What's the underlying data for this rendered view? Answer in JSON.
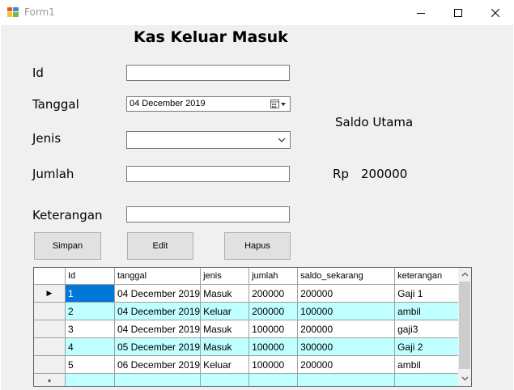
{
  "window": {
    "title": "Form1",
    "minimize_icon": "minimize-icon",
    "maximize_icon": "maximize-icon",
    "close_icon": "close-icon"
  },
  "form": {
    "heading": "Kas Keluar Masuk",
    "labels": {
      "id": "Id",
      "tanggal": "Tanggal",
      "jenis": "Jenis",
      "jumlah": "Jumlah",
      "keterangan": "Keterangan"
    },
    "fields": {
      "id_value": "",
      "tanggal_value": "04 December 2019",
      "jenis_value": "",
      "jumlah_value": "",
      "keterangan_value": ""
    },
    "saldo": {
      "label": "Saldo Utama",
      "currency": "Rp",
      "amount": "200000"
    },
    "buttons": {
      "simpan": "Simpan",
      "edit": "Edit",
      "hapus": "Hapus"
    }
  },
  "grid": {
    "columns": [
      "Id",
      "tanggal",
      "jenis",
      "jumlah",
      "saldo_sekarang",
      "keterangan"
    ],
    "rows": [
      [
        "1",
        "04 December 2019",
        "Masuk",
        "200000",
        "200000",
        "Gaji 1"
      ],
      [
        "2",
        "04 December 2019",
        "Keluar",
        "200000",
        "100000",
        "ambil"
      ],
      [
        "3",
        "04 December 2019",
        "Masuk",
        "100000",
        "200000",
        "gaji3"
      ],
      [
        "4",
        "05 December 2019",
        "Masuk",
        "100000",
        "300000",
        "Gaji 2"
      ],
      [
        "5",
        "06 December 2019",
        "Keluar",
        "100000",
        "200000",
        "ambil"
      ]
    ],
    "current_row_marker": "▶",
    "new_row_marker": "*",
    "row_colors": {
      "normal": "#ffffff",
      "alternate": "#c0ffff",
      "selected": "#0078d7"
    }
  }
}
